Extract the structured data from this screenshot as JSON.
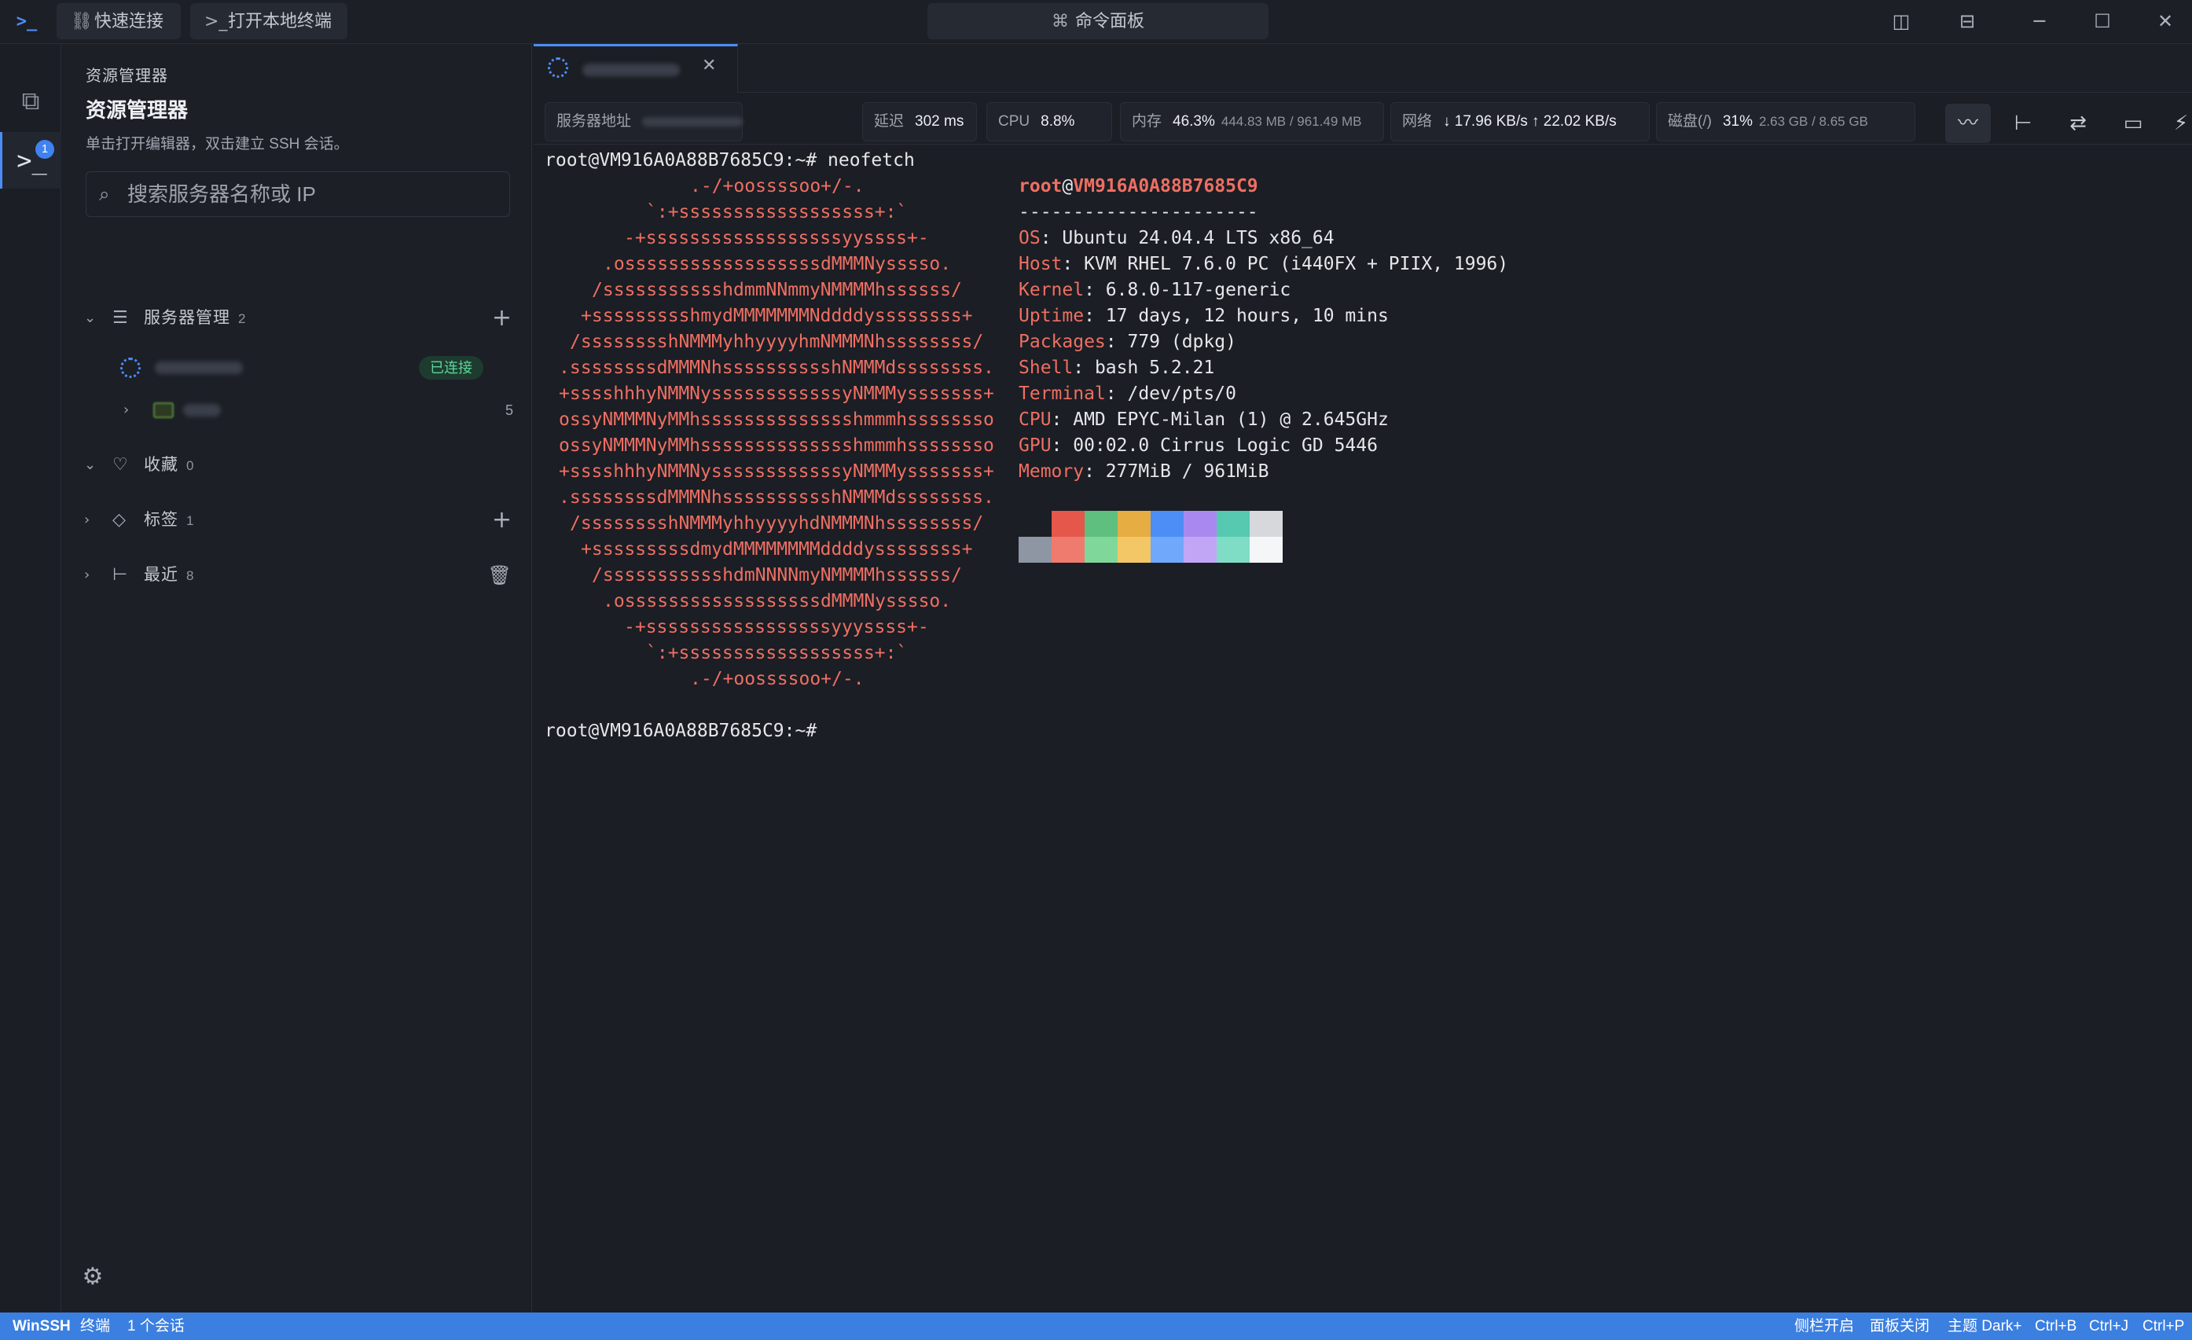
{
  "titlebar": {
    "quick_connect": "快速连接",
    "open_local_terminal": "打开本地终端",
    "command_palette": "命令面板"
  },
  "activitybar": {
    "terminal_badge": "1"
  },
  "sidebar": {
    "caption": "资源管理器",
    "title": "资源管理器",
    "description": "单击打开编辑器，双击建立 SSH 会话。",
    "search_placeholder": "搜索服务器名称或 IP",
    "sections": {
      "servers": {
        "label": "服务器管理",
        "count": "2"
      },
      "favorites": {
        "label": "收藏",
        "count": "0"
      },
      "tags": {
        "label": "标签",
        "count": "1"
      },
      "recent": {
        "label": "最近",
        "count": "8"
      }
    },
    "server_status": "已连接",
    "folder_count": "5"
  },
  "statusstrip": {
    "address_label": "服务器地址",
    "latency_label": "延迟",
    "latency_value": "302 ms",
    "cpu_label": "CPU",
    "cpu_value": "8.8%",
    "mem_label": "内存",
    "mem_percent": "46.3%",
    "mem_detail": "444.83 MB / 961.49 MB",
    "net_label": "网络",
    "net_value": "↓ 17.96 KB/s ↑ 22.02 KB/s",
    "disk_label": "磁盘(/)",
    "disk_percent": "31%",
    "disk_detail": "2.63 GB / 8.65 GB"
  },
  "terminal": {
    "command_line": "root@VM916A0A88B7685C9:~# neofetch",
    "prompt_line": "root@VM916A0A88B7685C9:~#",
    "logo_lines": [
      ".-/+oossssoo+/-.",
      "`:+ssssssssssssssssss+:`",
      "-+ssssssssssssssssssyyssss+-",
      ".ossssssssssssssssssdMMMNysssso.",
      "/ssssssssssshdmmNNmmyNMMMMhssssss/",
      "+ssssssssshmydMMMMMMMNddddyssssssss+",
      "/sssssssshNMMMyhhyyyyhmNMMMNhssssssss/",
      ".ssssssssdMMMNhsssssssssshNMMMdssssssss.",
      "+sssshhhyNMMNyssssssssssssyNMMMysssssss+",
      "ossyNMMMNyMMhsssssssssssssshmmmhssssssso",
      "ossyNMMMNyMMhsssssssssssssshmmmhssssssso",
      "+sssshhhyNMMNyssssssssssssyNMMMysssssss+",
      ".ssssssssdMMMNhsssssssssshNMMMdssssssss.",
      "/sssssssshNMMMyhhyyyyhdNMMMNhssssssss/",
      "+sssssssssdmydMMMMMMMMddddyssssssss+",
      "/ssssssssssshdmNNNNmyNMMMMhssssss/",
      ".ossssssssssssssssssdMMMNysssso.",
      "-+sssssssssssssssssyyyssss+-",
      "`:+ssssssssssssssssss+:`",
      ".-/+oossssoo+/-."
    ],
    "user": "root",
    "at": "@",
    "host": "VM916A0A88B7685C9",
    "separator": "----------------------",
    "info": [
      {
        "key": "OS",
        "value": "Ubuntu 24.04.4 LTS x86_64"
      },
      {
        "key": "Host",
        "value": "KVM RHEL 7.6.0 PC (i440FX + PIIX, 1996)"
      },
      {
        "key": "Kernel",
        "value": "6.8.0-117-generic"
      },
      {
        "key": "Uptime",
        "value": "17 days, 12 hours, 10 mins"
      },
      {
        "key": "Packages",
        "value": "779 (dpkg)"
      },
      {
        "key": "Shell",
        "value": "bash 5.2.21"
      },
      {
        "key": "Terminal",
        "value": "/dev/pts/0"
      },
      {
        "key": "CPU",
        "value": "AMD EPYC-Milan (1) @ 2.645GHz"
      },
      {
        "key": "GPU",
        "value": "00:02.0 Cirrus Logic GD 5446"
      },
      {
        "key": "Memory",
        "value": "277MiB / 961MiB"
      }
    ],
    "palette_top": [
      "#1b1e24",
      "#e5564b",
      "#5fbf7f",
      "#e5ad42",
      "#4c8ef5",
      "#a989ef",
      "#56c9b0",
      "#d7d8dc"
    ],
    "palette_bottom": [
      "#8e95a3",
      "#ef7b6e",
      "#7fd89a",
      "#f4c766",
      "#70a8fb",
      "#c1a6f6",
      "#7fdcc5",
      "#f5f6f8"
    ]
  },
  "statusbar": {
    "app_name": "WinSSH",
    "mode": "终端",
    "sessions": "1 个会话",
    "sidebar_toggle": "侧栏开启",
    "panel_toggle": "面板关闭",
    "theme": "主题 Dark+",
    "shortcut_b": "Ctrl+B",
    "shortcut_j": "Ctrl+J",
    "shortcut_p": "Ctrl+P"
  }
}
